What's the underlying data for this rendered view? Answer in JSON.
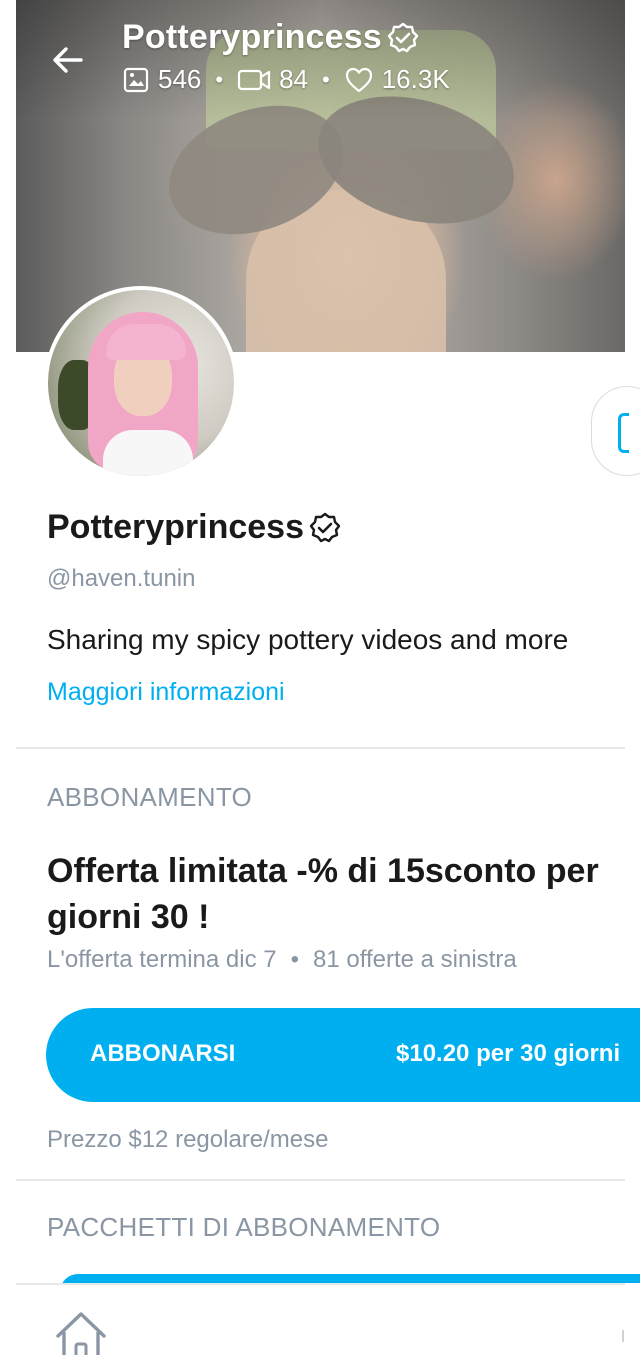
{
  "header": {
    "back_icon": "arrow-left-icon",
    "title": "Potteryprincess",
    "verified_icon": "verified-badge-icon",
    "stats": {
      "photos": "546",
      "videos": "84",
      "likes": "16.3K"
    }
  },
  "profile": {
    "name": "Potteryprincess",
    "handle": "@haven.tunin",
    "bio": "Sharing my spicy pottery videos and more",
    "more_link": "Maggiori informazioni"
  },
  "subscription": {
    "section_title": "ABBONAMENTO",
    "offer_title": "Offerta limitata -% di 15sconto per giorni 30 !",
    "offer_ends": "L'offerta termina dic 7",
    "offers_left": "81 offerte a sinistra",
    "button_label": "ABBONARSI",
    "button_price": "$10.20 per 30 giorni",
    "regular_price": "Prezzo $12 regolare/mese"
  },
  "bundles": {
    "section_title": "PACCHETTI DI ABBONAMENTO"
  },
  "colors": {
    "accent": "#00aff0",
    "muted": "#8a96a3",
    "text": "#1a1a1a",
    "divider": "#e6e9ec"
  }
}
